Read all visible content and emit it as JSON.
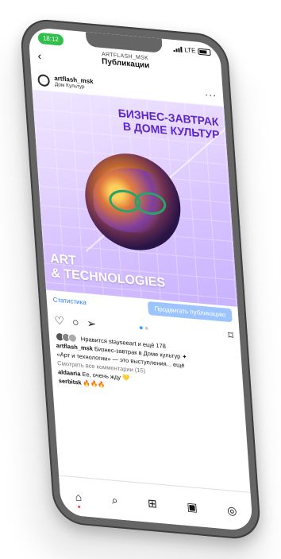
{
  "status_bar": {
    "time": "18:12",
    "network": "LTE"
  },
  "header": {
    "subtitle": "ARTFLASH_MSK",
    "title": "Публикации",
    "back_icon": "chevron-left-icon"
  },
  "author": {
    "name": "artflash_msk",
    "location": "Дом Культур",
    "more_icon": "more-horizontal-icon"
  },
  "post": {
    "title_line1": "БИЗНЕС-ЗАВТРАК",
    "title_line2": "В ДОМЕ КУЛЬТУР",
    "bottom_line1": "ART",
    "bottom_line2": "& TECHNOLOGIES"
  },
  "actions": {
    "stats_label": "Статистика",
    "promote_label": "Продвигать публикацию",
    "like_icon": "heart-icon",
    "comment_icon": "comment-icon",
    "share_icon": "send-icon",
    "save_icon": "bookmark-icon"
  },
  "carousel": {
    "count": 2,
    "active": 0
  },
  "caption": {
    "likes_text": "Нравится stayseeart и ещё 178",
    "author": "artflash_msk",
    "text": "Бизнес-завтрак в Доме культур",
    "text2": "«Арт и технологии» — это выступления... ещё",
    "view_comments": "Смотреть все комментарии (15)",
    "comment1_user": "aldaaria",
    "comment1_text": "Ее, очень жду",
    "comment2_user": "serbitsk"
  },
  "bottom_nav": {
    "home_icon": "home-icon",
    "search_icon": "search-icon",
    "add_icon": "add-icon",
    "reels_icon": "reels-icon",
    "profile_icon": "profile-icon"
  }
}
